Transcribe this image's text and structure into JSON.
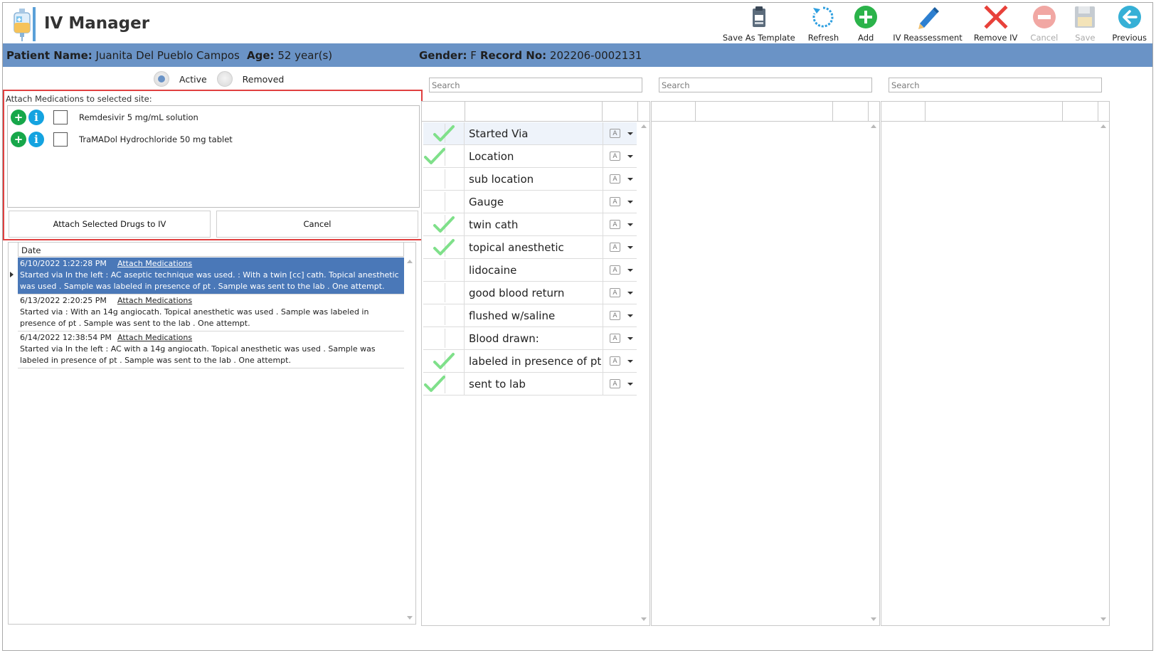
{
  "app": {
    "title": "IV Manager"
  },
  "toolbar": {
    "buttons": [
      {
        "label": "Save As Template",
        "icon": "clipboard-icon",
        "enabled": true
      },
      {
        "label": "Refresh",
        "icon": "refresh-icon",
        "enabled": true
      },
      {
        "label": "Add",
        "icon": "plus-circle-icon",
        "enabled": true
      },
      {
        "label": "IV Reassessment",
        "icon": "pencil-icon",
        "enabled": true
      },
      {
        "label": "Remove IV",
        "icon": "red-x-icon",
        "enabled": true
      },
      {
        "label": "Cancel",
        "icon": "minus-circle-icon",
        "enabled": false
      },
      {
        "label": "Save",
        "icon": "floppy-disk-icon",
        "enabled": false
      },
      {
        "label": "Previous",
        "icon": "back-arrow-icon",
        "enabled": true
      }
    ]
  },
  "patient": {
    "name_label": "Patient Name:",
    "name": "Juanita Del Pueblo Campos",
    "age_label": "Age:",
    "age": "52 year(s)",
    "gender_label": "Gender:",
    "gender": "F",
    "record_label": "Record No:",
    "record": "202206-0002131"
  },
  "filter": {
    "active_label": "Active",
    "removed_label": "Removed",
    "selected": "Active"
  },
  "attach": {
    "title": "Attach Medications to selected site:",
    "medications": [
      {
        "name": "Remdesivir 5 mg/mL solution",
        "checked": false
      },
      {
        "name": "TraMADol Hydrochloride 50 mg tablet",
        "checked": false
      }
    ],
    "attach_button": "Attach Selected Drugs to IV",
    "cancel_button": "Cancel"
  },
  "history": {
    "column_header": "Date",
    "rows": [
      {
        "date": "6/10/2022 1:22:28 PM",
        "link": "Attach Medications",
        "text": "Started via In the left : AC aseptic technique was used. : With a twin [cc] cath. Topical anesthetic was used . Sample was labeled in presence of pt . Sample was sent to the lab . One attempt.",
        "selected": true
      },
      {
        "date": "6/13/2022 2:20:25 PM",
        "link": "Attach Medications",
        "text": "Started via : With an 14g angiocath. Topical anesthetic was used . Sample was labeled in presence of pt . Sample was sent to the lab . One attempt.",
        "selected": false
      },
      {
        "date": "6/14/2022 12:38:54 PM",
        "link": "Attach Medications",
        "text": "Started via In the left : AC with a 14g angiocath. Topical anesthetic was used . Sample was labeled in presence of pt . Sample was sent to the lab . One attempt.",
        "selected": false
      }
    ]
  },
  "search": {
    "placeholder_1": "Search",
    "placeholder_2": "Search",
    "placeholder_3": "Search"
  },
  "observations": [
    {
      "label": "Started Via",
      "checked": true
    },
    {
      "label": "Location",
      "checked": true
    },
    {
      "label": "sub location",
      "checked": false
    },
    {
      "label": "Gauge",
      "checked": false
    },
    {
      "label": "twin cath",
      "checked": true
    },
    {
      "label": "topical anesthetic",
      "checked": true
    },
    {
      "label": "lidocaine",
      "checked": false
    },
    {
      "label": "good blood return",
      "checked": false
    },
    {
      "label": "flushed w/saline",
      "checked": false
    },
    {
      "label": "Blood drawn:",
      "checked": false
    },
    {
      "label": "labeled in presence of pt",
      "checked": true
    },
    {
      "label": "sent to lab",
      "checked": true
    }
  ],
  "colors": {
    "patient_bar": "#6a93c6",
    "selection": "#4a78b8",
    "highlight_border": "#e04040",
    "check_green": "#7fe08a"
  }
}
